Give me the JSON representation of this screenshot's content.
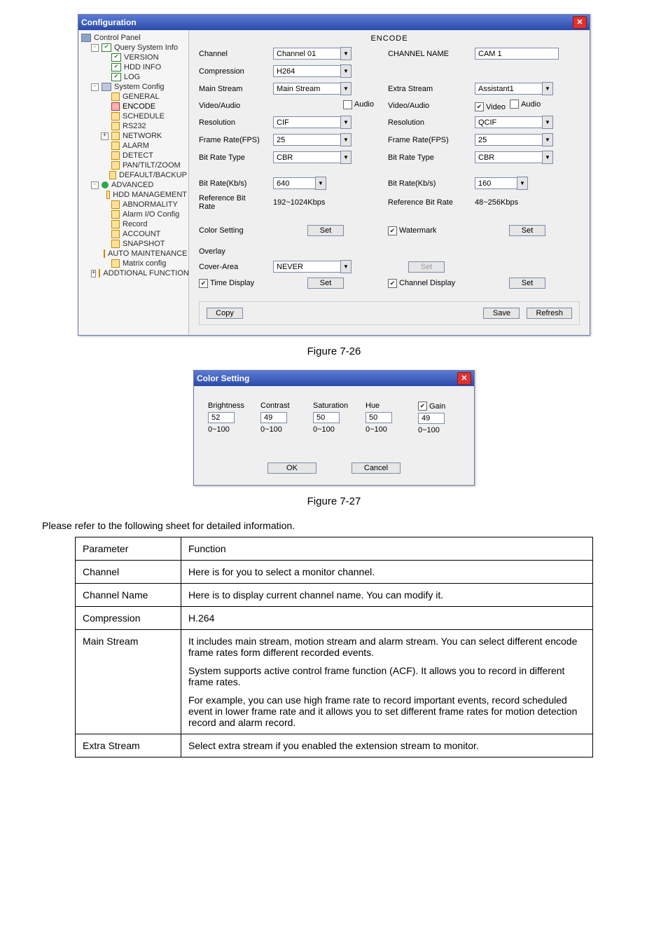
{
  "config": {
    "title": "Configuration",
    "section_title": "ENCODE",
    "tree": {
      "root": "Control Panel",
      "query": {
        "label": "Query System Info",
        "children": [
          "VERSION",
          "HDD INFO",
          "LOG"
        ]
      },
      "system": {
        "label": "System Config",
        "children": [
          "GENERAL",
          "ENCODE",
          "SCHEDULE",
          "RS232",
          "NETWORK",
          "ALARM",
          "DETECT",
          "PAN/TILT/ZOOM",
          "DEFAULT/BACKUP"
        ]
      },
      "advanced": {
        "label": "ADVANCED",
        "children": [
          "HDD MANAGEMENT",
          "ABNORMALITY",
          "Alarm I/O Config",
          "Record",
          "ACCOUNT",
          "SNAPSHOT",
          "AUTO MAINTENANCE",
          "Matrix config"
        ]
      },
      "addtional": {
        "label": "ADDTIONAL FUNCTION"
      }
    },
    "enc": {
      "channel_lbl": "Channel",
      "channel_val": "Channel 01",
      "channel_name_lbl": "CHANNEL NAME",
      "channel_name_val": "CAM 1",
      "compression_lbl": "Compression",
      "compression_val": "H264",
      "main_stream_lbl": "Main Stream",
      "main_stream_val": "Main Stream",
      "extra_stream_lbl": "Extra Stream",
      "extra_stream_val": "Assistant1",
      "video_audio_lbl": "Video/Audio",
      "audio_chk_lbl": "Audio",
      "video_chk_lbl": "Video",
      "audio2_chk_lbl": "Audio",
      "resolution_lbl": "Resolution",
      "resolution_val": "CIF",
      "resolution2_val": "QCIF",
      "fps_lbl": "Frame Rate(FPS)",
      "fps_val": "25",
      "fps2_val": "25",
      "brt_lbl": "Bit Rate Type",
      "brt_val": "CBR",
      "brt2_val": "CBR",
      "brk_lbl": "Bit Rate(Kb/s)",
      "brk_val": "640",
      "brk2_val": "160",
      "ref_lbl": "Reference Bit Rate",
      "ref_val": "192~1024Kbps",
      "ref2_val": "48~256Kbps",
      "color_lbl": "Color Setting",
      "set_lbl": "Set",
      "watermark_lbl": "Watermark",
      "overlay_lbl": "Overlay",
      "cover_lbl": "Cover-Area",
      "cover_val": "NEVER",
      "time_disp_lbl": "Time Display",
      "chan_disp_lbl": "Channel Display",
      "copy_lbl": "Copy",
      "save_lbl": "Save",
      "refresh_lbl": "Refresh"
    }
  },
  "figure_a": "Figure 7-26",
  "color_dlg": {
    "title": "Color Setting",
    "cols": [
      {
        "name": "Brightness",
        "value": "52",
        "range": "0~100"
      },
      {
        "name": "Contrast",
        "value": "49",
        "range": "0~100"
      },
      {
        "name": "Saturation",
        "value": "50",
        "range": "0~100"
      },
      {
        "name": "Hue",
        "value": "50",
        "range": "0~100"
      },
      {
        "name": "Gain",
        "value": "49",
        "range": "0~100",
        "chk": true
      }
    ],
    "ok": "OK",
    "cancel": "Cancel"
  },
  "figure_b": "Figure 7-27",
  "sheet_intro": "Please refer to the following sheet for detailed information.",
  "ptable": {
    "h_param": "Parameter",
    "h_func": "Function",
    "rows": [
      {
        "p": "Channel",
        "f": "Here is for you to select a monitor channel."
      },
      {
        "p": "Channel Name",
        "f": "Here is to display current channel name. You can modify it."
      },
      {
        "p": "Compression",
        "f": "H.264"
      },
      {
        "p": "Main Stream",
        "f1": "It includes main stream, motion stream and alarm stream. You can select different encode frame rates form different recorded events.",
        "f2": "System supports active control frame function (ACF). It allows you to record in different frame rates.",
        "f3": "For example, you can use high frame rate to record important events, record scheduled event in lower frame rate and it allows you to set different frame rates for motion detection record and alarm record."
      },
      {
        "p": "Extra Stream",
        "f": "Select extra stream if you enabled the extension stream to monitor."
      }
    ]
  }
}
